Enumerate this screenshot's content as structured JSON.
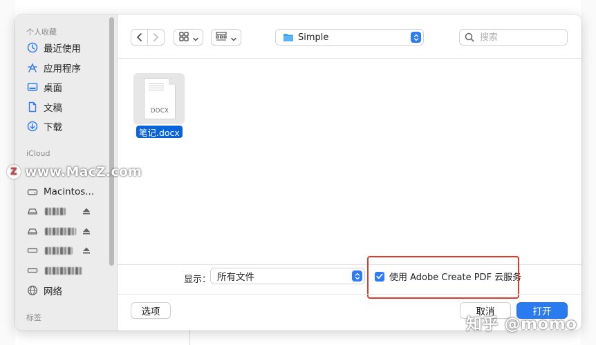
{
  "sidebar": {
    "sections": {
      "favorites": "个人收藏",
      "icloud": "iCloud",
      "tags": "标签"
    },
    "favorites": [
      {
        "label": "最近使用",
        "icon": "clock-icon"
      },
      {
        "label": "应用程序",
        "icon": "applications-icon"
      },
      {
        "label": "桌面",
        "icon": "desktop-icon"
      },
      {
        "label": "文稿",
        "icon": "document-icon"
      },
      {
        "label": "下载",
        "icon": "download-icon"
      }
    ],
    "locations": [
      {
        "label": "Macintos...",
        "icon": "drive-icon"
      },
      {
        "label": "",
        "icon": "external-drive-icon",
        "blurred": true
      },
      {
        "label": "",
        "icon": "external-drive-icon",
        "blurred": true
      },
      {
        "label": "",
        "icon": "disk-icon",
        "blurred": true
      },
      {
        "label": "",
        "icon": "disk-icon",
        "blurred": true
      },
      {
        "label": "网络",
        "icon": "globe-icon"
      }
    ]
  },
  "watermark_left": "www.MacZ.com",
  "watermark_badge": "Z",
  "toolbar": {
    "path_folder": "Simple",
    "search_placeholder": "搜索"
  },
  "files": [
    {
      "name": "笔记.docx",
      "ext": "DOCX",
      "selected": true
    }
  ],
  "footer": {
    "show_label": "显示：",
    "show_value": "所有文件",
    "checkbox_label": "使用 Adobe Create PDF 云服务",
    "checkbox_checked": true,
    "options_button": "选项",
    "cancel_button": "取消",
    "open_button": "打开"
  },
  "watermark_bottom": "知乎 @momo",
  "colors": {
    "accent": "#2e7cf6",
    "selection": "#0a63d9",
    "highlight_box": "#e23a2a",
    "sidebar_bg": "#ececec"
  }
}
